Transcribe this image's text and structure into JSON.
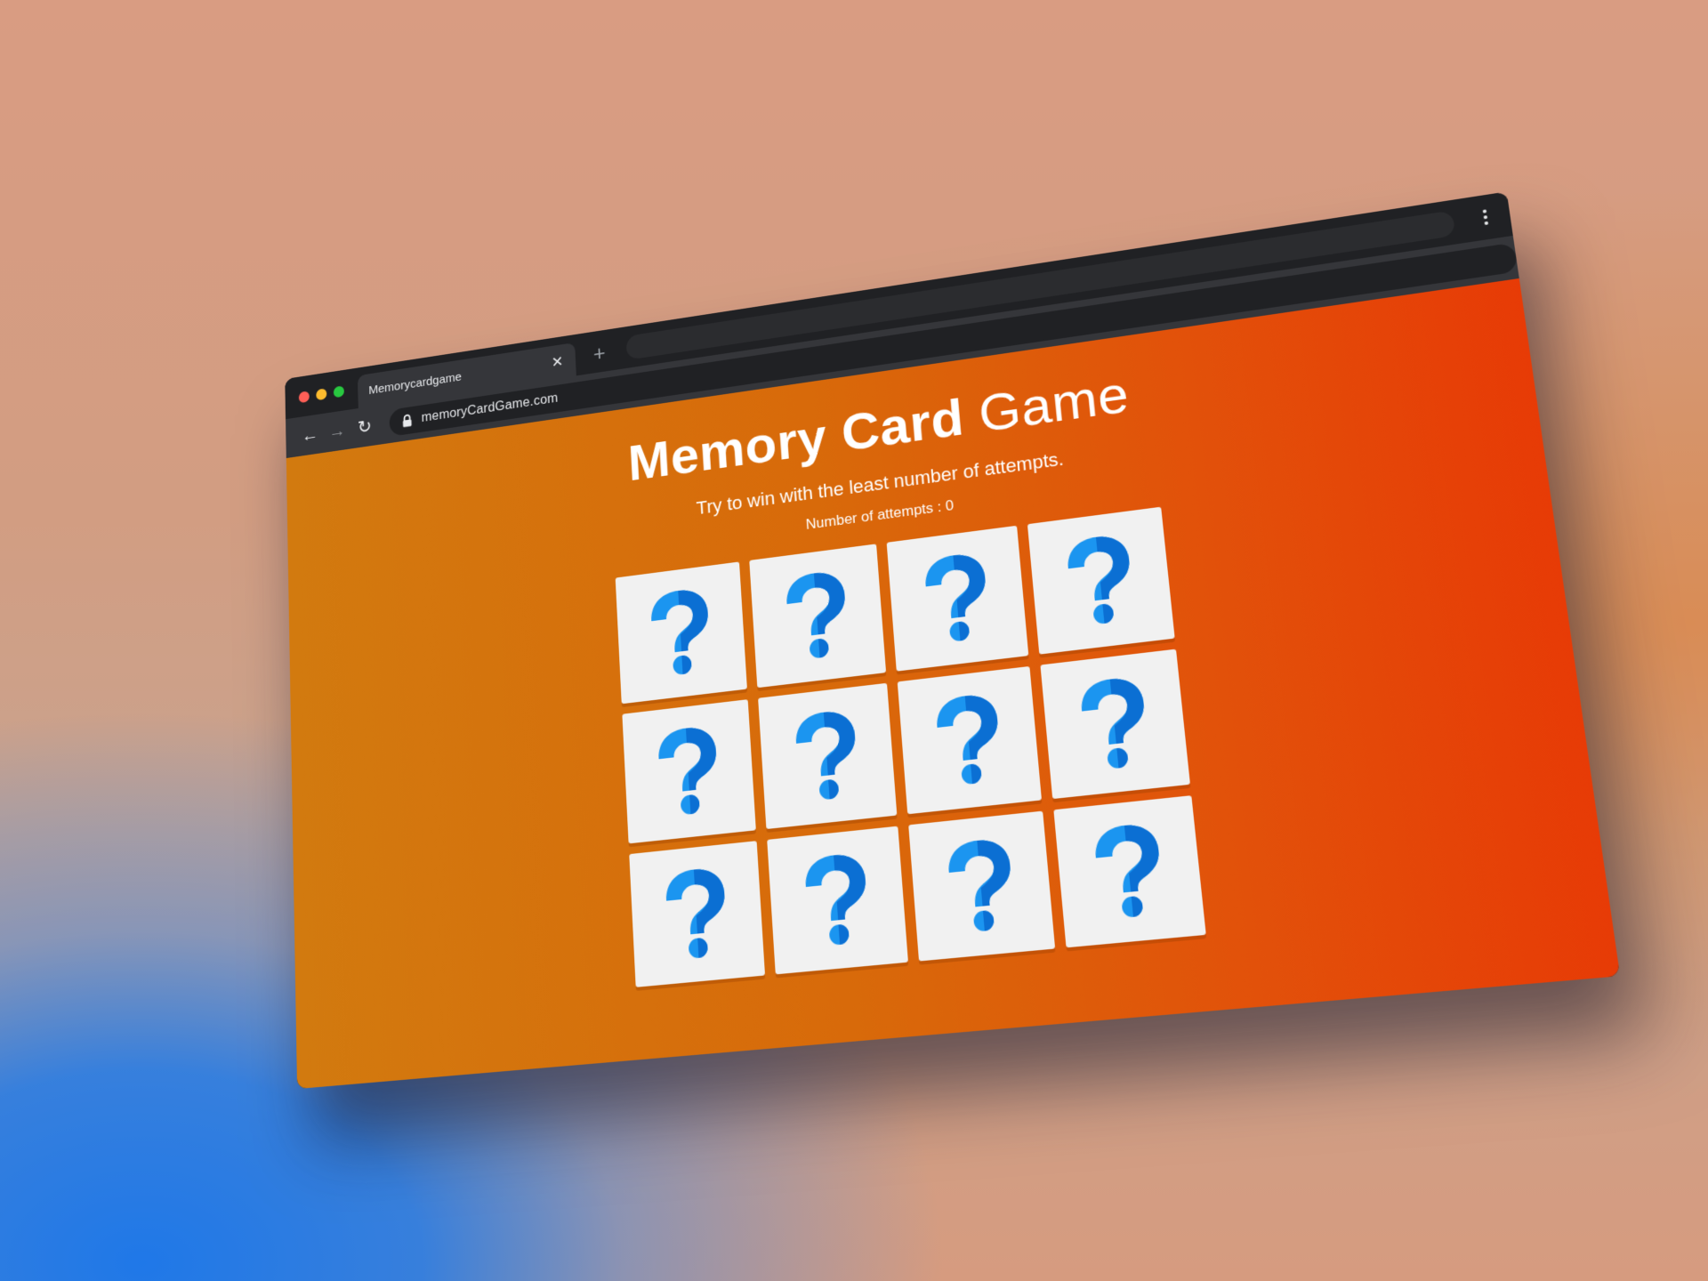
{
  "browser": {
    "tab_title": "Memorycardgame",
    "tab_close_label": "✕",
    "new_tab_label": "+",
    "url": "memoryCardGame.com",
    "nav": {
      "back_label": "←",
      "forward_label": "→",
      "reload_label": "↻"
    },
    "traffic_lights": [
      "#ff5f57",
      "#febc2e",
      "#28c840"
    ]
  },
  "game": {
    "title_bold": "Memory Card",
    "title_light": "Game",
    "subtitle": "Try to win with the least number of attempts.",
    "attempts_label": "Number of attempts : 0",
    "cards": [
      {
        "face": "question-mark",
        "flipped": false
      },
      {
        "face": "question-mark",
        "flipped": false
      },
      {
        "face": "question-mark",
        "flipped": false
      },
      {
        "face": "question-mark",
        "flipped": false
      },
      {
        "face": "question-mark",
        "flipped": false
      },
      {
        "face": "question-mark",
        "flipped": false
      },
      {
        "face": "question-mark",
        "flipped": false
      },
      {
        "face": "question-mark",
        "flipped": false
      },
      {
        "face": "question-mark",
        "flipped": false
      },
      {
        "face": "question-mark",
        "flipped": false
      },
      {
        "face": "question-mark",
        "flipped": false
      },
      {
        "face": "question-mark",
        "flipped": false
      }
    ],
    "colors": {
      "page_gradient_start": "#d27a0f",
      "page_gradient_end": "#e73b06",
      "card_background": "#f1f1f1",
      "question_mark_light": "#1b95f0",
      "question_mark_dark": "#0b6fd3"
    }
  }
}
